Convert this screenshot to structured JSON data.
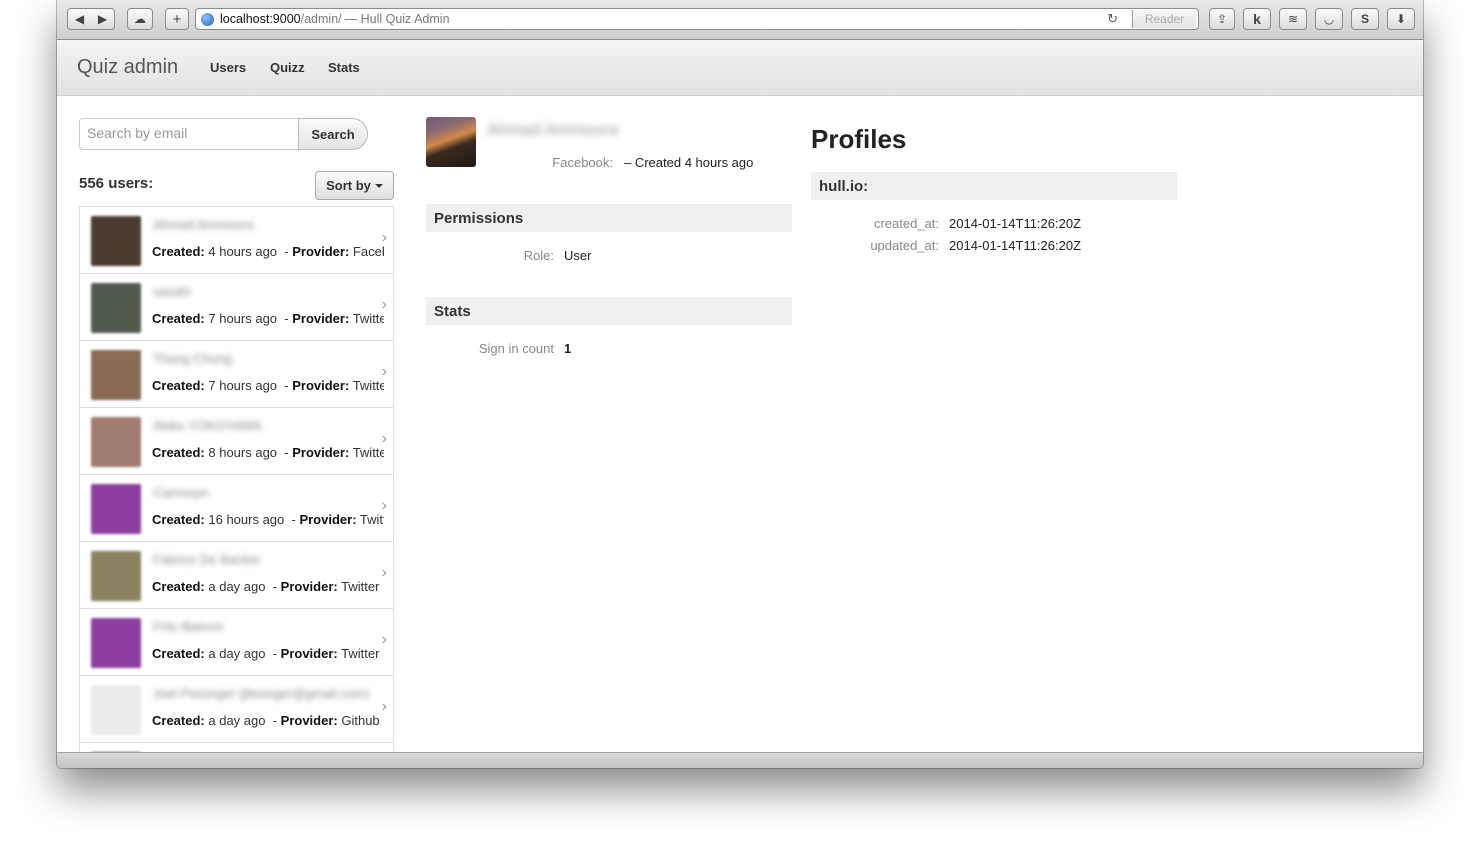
{
  "browser": {
    "url_host": "localhost:9000",
    "url_path": "/admin/",
    "page_title": "— Hull Quiz Admin",
    "reader_label": "Reader",
    "new_tab_label": "+",
    "k_label": "k",
    "s_label": "S"
  },
  "nav": {
    "brand": "Quiz admin",
    "links": [
      "Users",
      "Quizz",
      "Stats"
    ]
  },
  "search": {
    "placeholder": "Search by email",
    "button_label": "Search"
  },
  "users": {
    "count_label": "556 users:",
    "sort_label": "Sort by",
    "created_label": "Created:",
    "provider_label": "Provider:",
    "items": [
      {
        "name": "Ahmad Ammoura",
        "created": "4 hours ago",
        "provider": "Facebook",
        "avatar_color": "#4a3a30",
        "name_blur": true
      },
      {
        "name": "sasahi",
        "created": "7 hours ago",
        "provider": "Twitter",
        "avatar_color": "#505a4c",
        "name_blur": true
      },
      {
        "name": "Thang Chung",
        "created": "7 hours ago",
        "provider": "Twitter",
        "avatar_color": "#8a6b55",
        "name_blur": true
      },
      {
        "name": "Akiko YOKOYAMA",
        "created": "8 hours ago",
        "provider": "Twitter",
        "avatar_color": "#a07c70",
        "name_blur": true
      },
      {
        "name": "Camouyo",
        "created": "16 hours ago",
        "provider": "Twitter",
        "avatar_color": "#8d3fa0",
        "name_blur": true
      },
      {
        "name": "Fabrice De Backer",
        "created": "a day ago",
        "provider": "Twitter",
        "avatar_color": "#8a8260",
        "name_blur": true
      },
      {
        "name": "Fritz Batroni",
        "created": "a day ago",
        "provider": "Twitter",
        "avatar_color": "#8d3fa0",
        "name_blur": true
      },
      {
        "name": "Joel Petzinger (jfesinger@gmail.com)",
        "created": "a day ago",
        "provider": "Github",
        "avatar_color": "#ececec",
        "name_blur": true
      }
    ]
  },
  "detail": {
    "name": "Ahmad Ammoura",
    "facebook_label": "Facebook:",
    "facebook_value": "– Created 4 hours ago",
    "permissions_title": "Permissions",
    "role_label": "Role:",
    "role_value": "User",
    "stats_title": "Stats",
    "sign_in_label": "Sign in count",
    "sign_in_value": "1"
  },
  "profiles": {
    "title": "Profiles",
    "provider_title": "hull.io:",
    "created_at_label": "created_at:",
    "created_at_value": "2014-01-14T11:26:20Z",
    "updated_at_label": "updated_at:",
    "updated_at_value": "2014-01-14T11:26:20Z"
  }
}
